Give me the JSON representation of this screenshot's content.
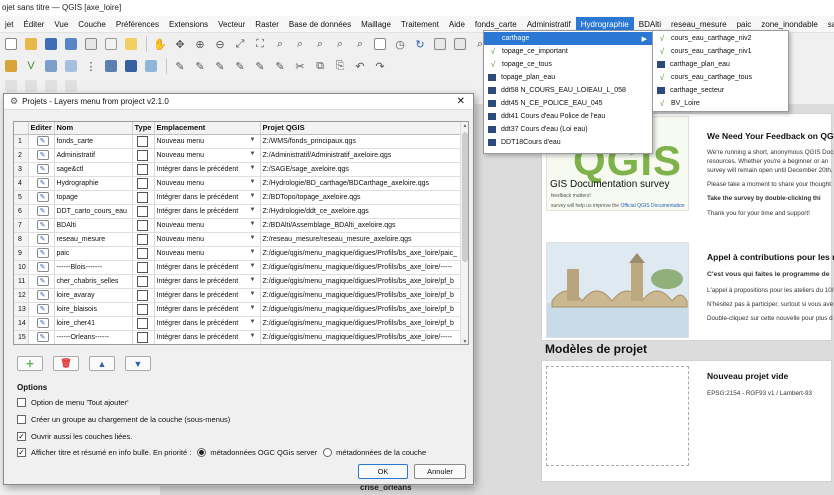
{
  "window": {
    "title": "ojet sans titre — QGIS [axe_loire]"
  },
  "menubar": [
    "jet",
    "Éditer",
    "Vue",
    "Couche",
    "Préférences",
    "Extensions",
    "Vecteur",
    "Raster",
    "Base de données",
    "Maillage",
    "Traitement",
    "Aide",
    "fonds_carte",
    "Administratif",
    "Hydrographie",
    "BDAlti",
    "reseau_mesure",
    "paic",
    "zone_inondable",
    "sage_vdl"
  ],
  "hydro_menu": {
    "items": [
      {
        "label": "carthage",
        "icon": "folder-icon",
        "selected": true,
        "submenu": true
      },
      {
        "label": "topage_ce_important",
        "icon": "line-layer-icon"
      },
      {
        "label": "topage_ce_tous",
        "icon": "line-layer-icon"
      },
      {
        "label": "topage_plan_eau",
        "icon": "polygon-layer-icon"
      },
      {
        "label": "ddt58 N_COURS_EAU_LOIEAU_L_058",
        "icon": "polygon-layer-icon"
      },
      {
        "label": "ddt45 N_CE_POLICE_EAU_045",
        "icon": "polygon-layer-icon"
      },
      {
        "label": "ddt41 Cours d'eau Police de l'eau",
        "icon": "polygon-layer-icon"
      },
      {
        "label": "ddt37 Cours d'eau (Loi eau)",
        "icon": "polygon-layer-icon"
      },
      {
        "label": "DDT18Cours d'eau",
        "icon": "polygon-layer-icon"
      }
    ]
  },
  "carthage_submenu": {
    "items": [
      {
        "label": "cours_eau_carthage_niv2",
        "icon": "line-layer-icon"
      },
      {
        "label": "cours_eau_carthage_niv1",
        "icon": "line-layer-icon"
      },
      {
        "label": "carthage_plan_eau",
        "icon": "polygon-layer-icon"
      },
      {
        "label": "cours_eau_carthage_tous",
        "icon": "line-layer-icon"
      },
      {
        "label": "carthage_secteur",
        "icon": "polygon-layer-icon"
      },
      {
        "label": "BV_Loire",
        "icon": "line-layer-icon"
      }
    ]
  },
  "dialog": {
    "title": "Projets - Layers menu from project v2.1.0",
    "columns": [
      "",
      "Editer",
      "Nom",
      "Type",
      "Emplacement",
      "Projet QGIS"
    ],
    "rows": [
      {
        "n": "1",
        "nom": "fonds_carte",
        "emp": "Nouveau menu",
        "proj": "Z:/WMS/fonds_principaux.qgs"
      },
      {
        "n": "2",
        "nom": "Administratif",
        "emp": "Nouveau menu",
        "proj": "Z:/Administratif/Administratif_axeloire.qgs"
      },
      {
        "n": "3",
        "nom": "sage&ctl",
        "emp": "Intégrer dans le précédent",
        "proj": "Z:/SAGE/sage_axeloire.qgs"
      },
      {
        "n": "4",
        "nom": "Hydrographie",
        "emp": "Nouveau menu",
        "proj": "Z:/Hydrologie/BD_carthage/BDCarthage_axeloire.qgs"
      },
      {
        "n": "5",
        "nom": "topage",
        "emp": "Intégrer dans le précédent",
        "proj": "Z:/BDTopo/topage_axeloire.qgs"
      },
      {
        "n": "6",
        "nom": "DDT_carto_cours_eau",
        "emp": "Intégrer dans le précédent",
        "proj": "Z:/Hydrologie/ddt_ce_axeloire.qgs"
      },
      {
        "n": "7",
        "nom": "BDAlti",
        "emp": "Nouveau menu",
        "proj": "Z:/BDAlti/Assemblage_BDAlti_axeloire.qgs"
      },
      {
        "n": "8",
        "nom": "reseau_mesure",
        "emp": "Nouveau menu",
        "proj": "Z:/reseau_mesure/reseau_mesure_axeloire.qgs"
      },
      {
        "n": "9",
        "nom": "paic",
        "emp": "Nouveau menu",
        "proj": "Z:/digue/qgis/menu_magique/digues/Profils/bs_axe_loire/paic_"
      },
      {
        "n": "10",
        "nom": "------Blois-------",
        "emp": "Intégrer dans le précédent",
        "proj": "Z:/digue/qgis/menu_magique/digues/Profils/bs_axe_loire/-----"
      },
      {
        "n": "11",
        "nom": "cher_chabris_selles",
        "emp": "Intégrer dans le précédent",
        "proj": "Z:/digue/qgis/menu_magique/digues/Profils/bs_axe_loire/pf_b"
      },
      {
        "n": "12",
        "nom": "loire_avaray",
        "emp": "Intégrer dans le précédent",
        "proj": "Z:/digue/qgis/menu_magique/digues/Profils/bs_axe_loire/pf_b"
      },
      {
        "n": "13",
        "nom": "loire_blaisois",
        "emp": "Intégrer dans le précédent",
        "proj": "Z:/digue/qgis/menu_magique/digues/Profils/bs_axe_loire/pf_b"
      },
      {
        "n": "14",
        "nom": "loire_cher41",
        "emp": "Intégrer dans le précédent",
        "proj": "Z:/digue/qgis/menu_magique/digues/Profils/bs_axe_loire/pf_b"
      },
      {
        "n": "15",
        "nom": "------Orleans------",
        "emp": "Intégrer dans le précédent",
        "proj": "Z:/digue/qgis/menu_magique/digues/Profils/bs_axe_loire/-----"
      }
    ],
    "options_title": "Options",
    "opt1": "Option de menu 'Tout ajouter'",
    "opt2": "Créer un groupe au chargement de la couche (sous-menus)",
    "opt3": "Ouvrir aussi les couches liées.",
    "opt4": "Afficher titre et résumé en info bulle. En priorité :",
    "radio1": "métadonnées OGC QGis server",
    "radio2": "métadonnées de la couche",
    "ok": "OK",
    "cancel": "Annuler"
  },
  "welcome": {
    "survey_title": "GIS Documentation survey",
    "survey_small1": "feedback matters!",
    "survey_small2": "survey will help us improve the",
    "survey_link": "Official QGIS Documentation",
    "news1_title": "We Need Your Feedback on QG",
    "news1_lines": [
      "We're running a short, anonymous QGIS Doc",
      "resources. Whether you're a beginner or an",
      "survey will remain open until December 20th."
    ],
    "news1_line4": "Please take a moment to share your thought",
    "news1_line5": "Take the survey by double-clicking thi",
    "news1_line6": "Thank you for your time and support!",
    "news2_title": "Appel à contributions pour les r",
    "news2_sub": "C'est vous qui faites le programme de",
    "news2_l1": "L'appel à propositions pour les ateliers du 10/",
    "news2_l2": "N'hésitez pas à participer, surtout si vous ave",
    "news2_l3": "Double-cliquez sur cette nouvelle pour plus d",
    "templates_title": "Modèles de projet",
    "template_name": "Nouveau projet vide",
    "template_crs": "EPSG:2154 - RGF93 v1 / Lambert-93",
    "crise": "crise_orleans"
  }
}
